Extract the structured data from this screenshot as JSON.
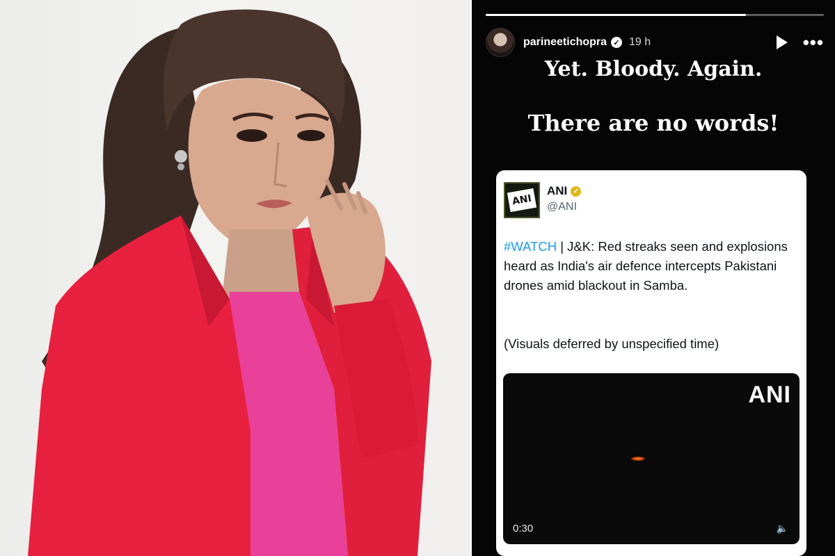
{
  "story": {
    "username": "parineetichopra",
    "time": "19 h",
    "progress_fraction": 0.77,
    "headline_1": "Yet. Bloody. Again.",
    "headline_2": "There are no words!",
    "icons": {
      "verified": "verified-badge-icon",
      "play": "play-icon",
      "more": "more-options-icon"
    }
  },
  "tweet": {
    "logo_text": "ANI",
    "name": "ANI",
    "handle": "@ANI",
    "hashtag": "#WATCH",
    "text_after_hashtag": " | J&K: Red streaks seen and explosions heard as India's air defence intercepts Pakistani drones amid blackout in Samba.",
    "note": "(Visuals deferred by unspecified time)",
    "video": {
      "watermark": "ANI",
      "duration": "0:30",
      "volume_icon": "volume-icon"
    }
  },
  "colors": {
    "blazer": "#e8203f",
    "top": "#e9409a",
    "hashtag": "#1d9bf0",
    "verified_gold": "#e2b719"
  }
}
